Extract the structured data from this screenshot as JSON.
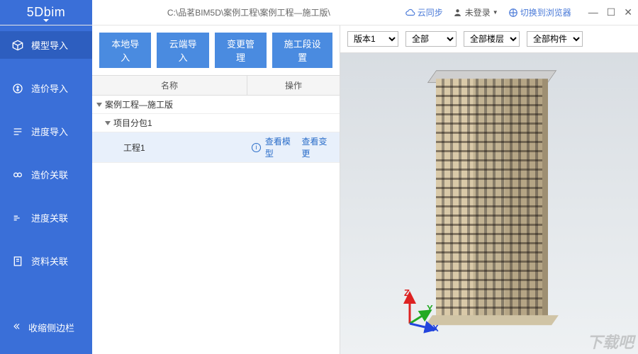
{
  "titlebar": {
    "logo": "5Dbim",
    "path": "C:\\品茗BIM5D\\案例工程\\案例工程—施工版\\",
    "cloud_sync": "云同步",
    "not_logged_in": "未登录",
    "switch_browser": "切换到浏览器"
  },
  "sidebar": {
    "items": [
      {
        "label": "模型导入",
        "active": true
      },
      {
        "label": "造价导入",
        "active": false
      },
      {
        "label": "进度导入",
        "active": false
      },
      {
        "label": "造价关联",
        "active": false
      },
      {
        "label": "进度关联",
        "active": false
      },
      {
        "label": "资料关联",
        "active": false
      }
    ],
    "collapse_label": "收缩侧边栏"
  },
  "toolbar": {
    "buttons": [
      "本地导入",
      "云端导入",
      "变更管理",
      "施工段设置"
    ]
  },
  "tree": {
    "header": {
      "name": "名称",
      "ops": "操作"
    },
    "rows": [
      {
        "label": "案例工程—施工版"
      },
      {
        "label": "项目分包1"
      },
      {
        "label": "工程1",
        "view": "查看模型",
        "change": "查看变更"
      }
    ]
  },
  "viewer": {
    "version_label": "版本1",
    "filter_all": "全部",
    "filter_floors": "全部楼层",
    "filter_components": "全部构件",
    "axis": {
      "x": "X",
      "y": "Y",
      "z": "Z"
    }
  },
  "watermark": "下载吧"
}
